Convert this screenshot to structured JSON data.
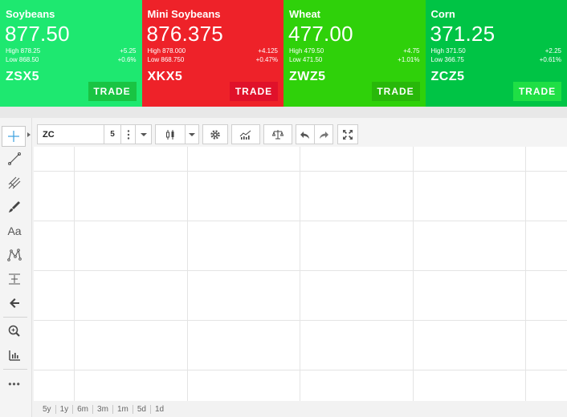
{
  "cards": [
    {
      "name": "Soybeans",
      "price": "877.50",
      "high": "High 878.25",
      "change": "+5.25",
      "low": "Low 868.50",
      "change_pct": "+0.6%",
      "symbol": "ZSX5",
      "trade_label": "TRADE",
      "bg": "#1ee870",
      "btn_bg": "#19c443"
    },
    {
      "name": "Mini Soybeans",
      "price": "876.375",
      "high": "High 878.000",
      "change": "+4.125",
      "low": "Low 868.750",
      "change_pct": "+0.47%",
      "symbol": "XKX5",
      "trade_label": "TRADE",
      "bg": "#ee2229",
      "btn_bg": "#e0112a"
    },
    {
      "name": "Wheat",
      "price": "477.00",
      "high": "High 479.50",
      "change": "+4.75",
      "low": "Low 471.50",
      "change_pct": "+1.01%",
      "symbol": "ZWZ5",
      "trade_label": "TRADE",
      "bg": "#2fd10a",
      "btn_bg": "#28b80a"
    },
    {
      "name": "Corn",
      "price": "371.25",
      "high": "High 371.50",
      "change": "+2.25",
      "low": "Low 366.75",
      "change_pct": "+0.61%",
      "symbol": "ZCZ5",
      "trade_label": "TRADE",
      "bg": "#00c445",
      "btn_bg": "#1fdf45"
    }
  ],
  "toolbar": {
    "symbol_value": "ZC",
    "interval": "5",
    "icons": [
      "more-vertical-icon",
      "chevron-down-icon",
      "candlestick-icon",
      "chevron-down-icon",
      "gear-icon",
      "indicators-icon",
      "compare-icon",
      "undo-icon",
      "redo-icon",
      "fullscreen-icon"
    ]
  },
  "left_tools": [
    "crosshair-icon",
    "trend-line-icon",
    "fork-icon",
    "brush-icon",
    "text-icon",
    "pattern-icon",
    "measure-icon",
    "arrow-left-icon",
    "zoom-icon",
    "ruler-icon",
    "more-icon"
  ],
  "left_tools_text": {
    "text_tool": "Aa",
    "more": "•••"
  },
  "ranges": [
    "5y",
    "1y",
    "6m",
    "3m",
    "1m",
    "5d",
    "1d"
  ]
}
